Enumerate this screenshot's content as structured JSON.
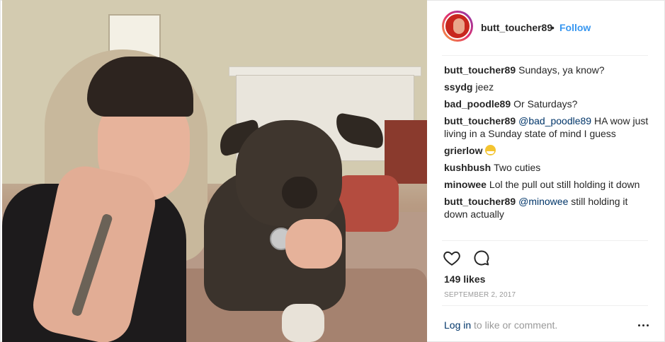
{
  "post": {
    "author": "butt_toucher89",
    "separator": "•",
    "follow_label": "Follow"
  },
  "comments": [
    {
      "user": "butt_toucher89",
      "text": "Sundays, ya know?"
    },
    {
      "user": "ssydg",
      "text": "jeez"
    },
    {
      "user": "bad_poodle89",
      "text": "Or Saturdays?"
    },
    {
      "user": "butt_toucher89",
      "mention": "@bad_poodle89",
      "text": " HA wow just living in a Sunday state of mind I guess"
    },
    {
      "user": "grierlow",
      "emoji": "grinning-face-emoji"
    },
    {
      "user": "kushbush",
      "text": "Two cuties"
    },
    {
      "user": "minowee",
      "text": "Lol the pull out still holding it down"
    },
    {
      "user": "butt_toucher89",
      "mention": "@minowee",
      "text": " still holding it down actually"
    }
  ],
  "actions": {
    "like_icon": "heart-icon",
    "comment_icon": "comment-icon"
  },
  "likes": "149 likes",
  "date": "SEPTEMBER 2, 2017",
  "login": {
    "link": "Log in",
    "rest": " to like or comment."
  },
  "colors": {
    "link_blue": "#3897f0",
    "mention": "#003569",
    "muted": "#999999"
  }
}
